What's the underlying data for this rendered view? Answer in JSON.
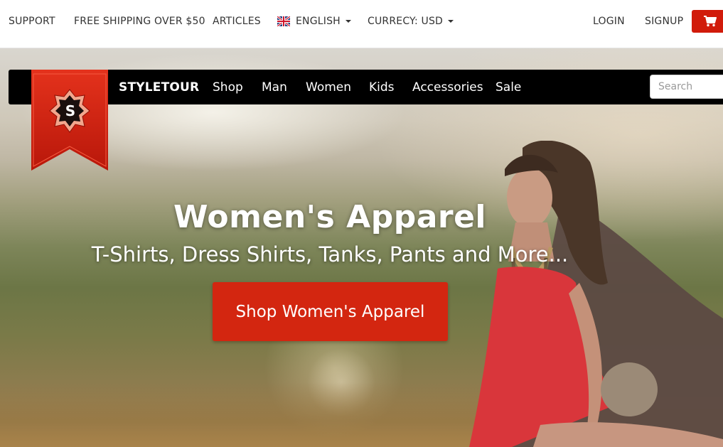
{
  "topbar": {
    "support": "SUPPORT",
    "shipping": "FREE SHIPPING OVER $50",
    "articles": "ARTICLES",
    "language": "ENGLISH",
    "currency": "CURRECY: USD",
    "login": "LOGIN",
    "signup": "SIGNUP"
  },
  "navbar": {
    "logo_letter": "S",
    "brand": "STYLETOUR",
    "links": [
      "Shop",
      "Man",
      "Women",
      "Kids",
      "Accessories",
      "Sale"
    ],
    "search_placeholder": "Search"
  },
  "hero": {
    "title": "Women's Apparel",
    "subtitle": "T-Shirts, Dress Shirts, Tanks, Pants and More...",
    "cta_label": "Shop Women's Apparel"
  },
  "icons": {
    "flag": "uk-flag-icon",
    "cart": "cart-icon",
    "logo": "ribbon-logo-icon"
  },
  "colors": {
    "accent": "#d11b0a",
    "cta": "#d32610",
    "navbar": "#000000",
    "text": "#333333"
  }
}
